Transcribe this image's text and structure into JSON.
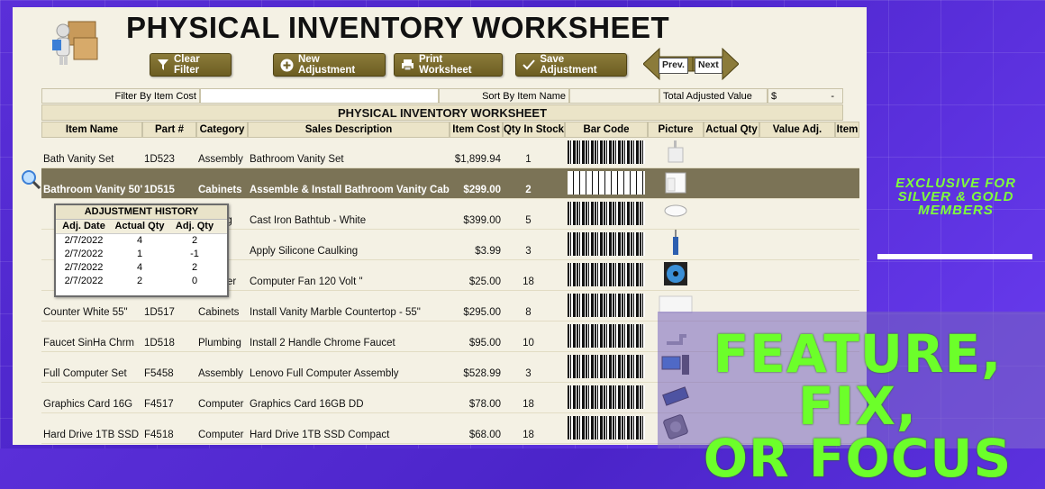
{
  "header": {
    "title": "PHYSICAL INVENTORY WORKSHEET"
  },
  "toolbar": {
    "clear_filter": "Clear Filter",
    "new_adjustment": "New Adjustment",
    "print_worksheet": "Print Worksheet",
    "save_adjustment": "Save Adjustment",
    "prev": "Prev.",
    "next": "Next"
  },
  "filter": {
    "filter_by_label": "Filter By",
    "filter_by_value": "Item Cost",
    "filter_input_value": "",
    "sort_by_label": "Sort By",
    "sort_by_value": "Item Name",
    "total_adjusted_label": "Total Adjusted Value",
    "total_currency": "$",
    "total_value": "-"
  },
  "table": {
    "banner": "PHYSICAL INVENTORY WORKSHEET",
    "columns": [
      "Item Name",
      "Part #",
      "Category",
      "Sales Description",
      "Item Cost",
      "Qty In Stock",
      "Bar Code",
      "Picture",
      "Actual Qty",
      "Value Adj.",
      "Item"
    ],
    "rows": [
      {
        "name": "Bath Vanity Set",
        "part": "1D523",
        "category": "Assembly",
        "desc": "Bathroom Vanity Set",
        "cost": "$1,899.94",
        "qty": "1",
        "picture": "sink-icon"
      },
      {
        "name": "Bathroom Vanity 50\"",
        "part": "1D515",
        "category": "Cabinets",
        "desc": "Assemble & Install Bathroom Vanity Cabir",
        "cost": "$299.00",
        "qty": "2",
        "picture": "cabinet-icon"
      },
      {
        "name": "",
        "part": "",
        "category": "umbing",
        "desc": "Cast Iron Bathtub - White",
        "cost": "$399.00",
        "qty": "5",
        "picture": "bathtub-icon"
      },
      {
        "name": "",
        "part": "",
        "category": "pplies",
        "desc": "Apply Silicone Caulking",
        "cost": "$3.99",
        "qty": "3",
        "picture": "caulk-icon"
      },
      {
        "name": "",
        "part": "",
        "category": "omputer",
        "desc": "Computer Fan 120 Volt \"",
        "cost": "$25.00",
        "qty": "18",
        "picture": "fan-icon"
      },
      {
        "name": "Counter White 55\"",
        "part": "1D517",
        "category": "Cabinets",
        "desc": "Install Vanity Marble Countertop - 55\"",
        "cost": "$295.00",
        "qty": "8",
        "picture": "countertop-icon"
      },
      {
        "name": "Faucet SinHa Chrm",
        "part": "1D518",
        "category": "Plumbing",
        "desc": "Install 2 Handle Chrome Faucet",
        "cost": "$95.00",
        "qty": "10",
        "picture": "faucet-icon"
      },
      {
        "name": "Full Computer Set",
        "part": "F5458",
        "category": "Assembly",
        "desc": "Lenovo Full Computer Assembly",
        "cost": "$528.99",
        "qty": "3",
        "picture": "computer-icon"
      },
      {
        "name": "Graphics Card 16G",
        "part": "F4517",
        "category": "Computer",
        "desc": "Graphics Card 16GB DD",
        "cost": "$78.00",
        "qty": "18",
        "picture": "graphics-card-icon"
      },
      {
        "name": "Hard Drive 1TB SSD",
        "part": "F4518",
        "category": "Computer",
        "desc": "Hard Drive 1TB SSD Compact",
        "cost": "$68.00",
        "qty": "18",
        "picture": "hard-drive-icon"
      }
    ]
  },
  "adjustment_history": {
    "title": "ADJUSTMENT HISTORY",
    "columns": [
      "Adj. Date",
      "Actual Qty",
      "Adj. Qty"
    ],
    "rows": [
      [
        "2/7/2022",
        "4",
        "2"
      ],
      [
        "2/7/2022",
        "1",
        "-1"
      ],
      [
        "2/7/2022",
        "4",
        "2"
      ],
      [
        "2/7/2022",
        "2",
        "0"
      ]
    ]
  },
  "promo": {
    "exclusive_line1": "EXCLUSIVE FOR",
    "exclusive_line2": "SILVER & GOLD",
    "exclusive_line3": "MEMBERS",
    "feature_line1": "FEATURE, FIX,",
    "feature_line2": "OR FOCUS"
  },
  "colors": {
    "button": "#7a6b2c",
    "selected_row": "#7b7356",
    "promo_green": "#6cff2a",
    "background": "#5a2fd8"
  }
}
